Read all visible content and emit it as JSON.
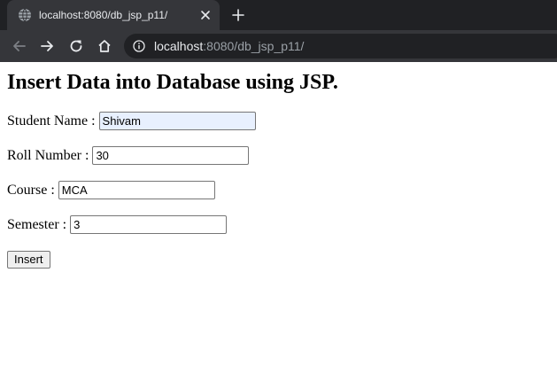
{
  "browser": {
    "tab_title": "localhost:8080/db_jsp_p11/",
    "url_host": "localhost",
    "url_rest": ":8080/db_jsp_p11/",
    "colors": {
      "tabstrip": "#202124",
      "toolbar": "#35363a",
      "omnibox": "#202124",
      "text": "#e8eaed",
      "muted_text": "#9aa0a6"
    },
    "icons": {
      "tab_favicon": "globe-icon",
      "tab_close": "close-icon",
      "new_tab": "plus-icon",
      "back": "arrow-left-icon",
      "forward": "arrow-right-icon",
      "reload": "reload-icon",
      "home": "home-icon",
      "site_info": "info-icon"
    }
  },
  "page": {
    "title": "Insert Data into Database using JSP.",
    "form": {
      "fields": [
        {
          "label": "Student Name :",
          "value": "Shivam",
          "autofilled": true
        },
        {
          "label": "Roll Number :",
          "value": "30"
        },
        {
          "label": "Course :",
          "value": "MCA"
        },
        {
          "label": "Semester :",
          "value": "3"
        }
      ],
      "submit_label": "Insert"
    }
  }
}
